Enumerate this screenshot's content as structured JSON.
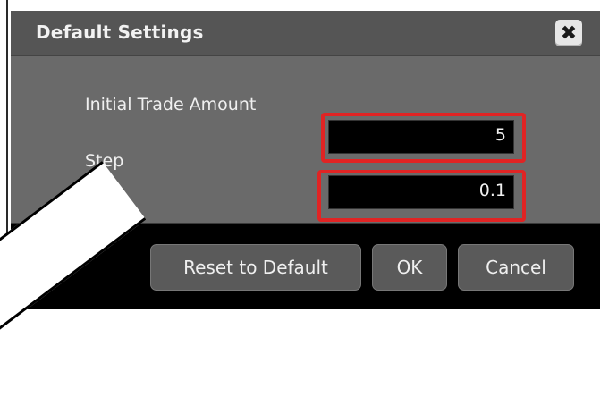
{
  "dialog": {
    "title": "Default Settings",
    "close_glyph": "✖",
    "fields": {
      "initial_trade_amount": {
        "label": "Initial Trade Amount",
        "value": "5"
      },
      "step": {
        "label": "Step",
        "value": "0.1"
      }
    },
    "buttons": {
      "reset_default": "Reset to Default",
      "ok": "OK",
      "cancel": "Cancel"
    }
  },
  "colors": {
    "highlight": "#e02424",
    "dialog_bg": "#6a6a6a",
    "footer_bg": "#000000"
  }
}
